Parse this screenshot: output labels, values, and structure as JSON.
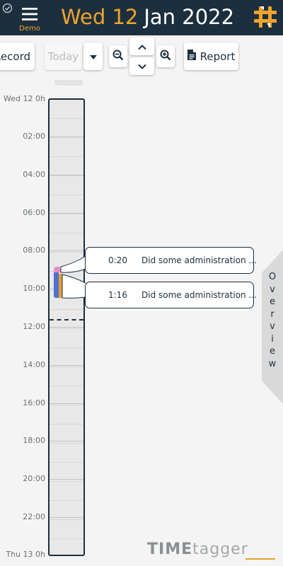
{
  "header": {
    "menu_label": "Demo",
    "date_day": "Wed 12",
    "date_month": "Jan 2022",
    "icons": {
      "sync": "sync-check-icon",
      "menu": "hamburger-menu-icon",
      "logo": "timetagger-logo-icon"
    }
  },
  "toolbar": {
    "record_label": "Record",
    "today_label": "Today",
    "report_label": "Report",
    "icons": {
      "dropdown": "caret-down-icon",
      "zoom_out": "zoom-out-icon",
      "up": "chevron-up-icon",
      "down": "chevron-down-icon",
      "zoom_in": "zoom-in-icon",
      "report": "document-icon"
    }
  },
  "timeline": {
    "start_label": "Wed 12 0h",
    "end_label": "Thu 13 0h",
    "hour_labels": [
      "02:00",
      "04:00",
      "06:00",
      "08:00",
      "10:00",
      "12:00",
      "14:00",
      "16:00",
      "18:00",
      "20:00",
      "22:00"
    ]
  },
  "records": [
    {
      "duration": "0:20",
      "description": "Did some administration ...",
      "color": "#e58fc5"
    },
    {
      "duration": "1:16",
      "description": "Did some administration ...",
      "color": "#4f6fd1"
    }
  ],
  "overview_label": "Overview",
  "branding": {
    "time": "TIME",
    "tagger": "tagger"
  },
  "colors": {
    "navy": "#1c2f3e",
    "accent": "#f0a42c",
    "background": "#f4f4f4"
  }
}
